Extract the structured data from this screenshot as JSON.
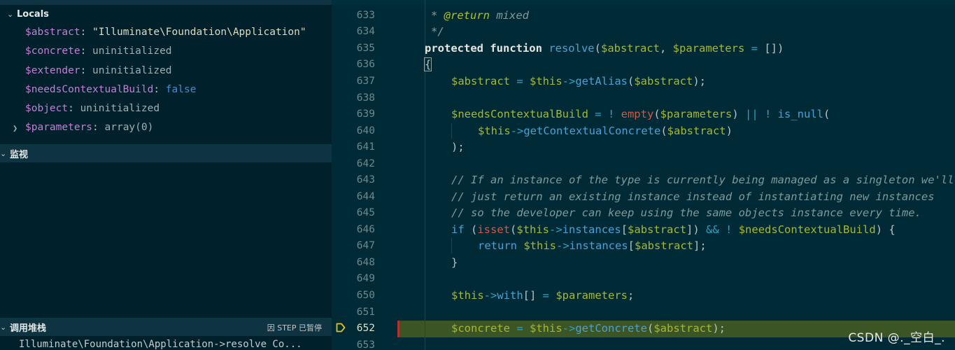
{
  "locals": {
    "header": "Locals",
    "vars": [
      {
        "name": "$abstract",
        "value": "\"Illuminate\\Foundation\\Application\"",
        "kind": "string"
      },
      {
        "name": "$concrete",
        "value": "uninitialized",
        "kind": "plain"
      },
      {
        "name": "$extender",
        "value": "uninitialized",
        "kind": "plain"
      },
      {
        "name": "$needsContextualBuild",
        "value": "false",
        "kind": "bool"
      },
      {
        "name": "$object",
        "value": "uninitialized",
        "kind": "plain"
      },
      {
        "name": "$parameters",
        "value": "array(0)",
        "kind": "plain"
      }
    ]
  },
  "watch": {
    "header": "监视"
  },
  "callstack": {
    "header": "调用堆栈",
    "status": "因 STEP 已暂停",
    "frame": "Illuminate\\Foundation\\Application->resolve  Co..."
  },
  "editor": {
    "current_line": 652,
    "lines": [
      {
        "n": "633",
        "code": "* @return mixed"
      },
      {
        "n": "634",
        "code": "*/"
      },
      {
        "n": "635",
        "code": "protected function resolve($abstract, $parameters = [])"
      },
      {
        "n": "636",
        "code": "{"
      },
      {
        "n": "637",
        "code": "$abstract = $this->getAlias($abstract);"
      },
      {
        "n": "638",
        "code": ""
      },
      {
        "n": "639",
        "code": "$needsContextualBuild = ! empty($parameters) || ! is_null("
      },
      {
        "n": "640",
        "code": "$this->getContextualConcrete($abstract)"
      },
      {
        "n": "641",
        "code": ");"
      },
      {
        "n": "642",
        "code": ""
      },
      {
        "n": "643",
        "code": "// If an instance of the type is currently being managed as a singleton we'll"
      },
      {
        "n": "644",
        "code": "// just return an existing instance instead of instantiating new instances"
      },
      {
        "n": "645",
        "code": "// so the developer can keep using the same objects instance every time."
      },
      {
        "n": "646",
        "code": "if (isset($this->instances[$abstract]) && ! $needsContextualBuild) {"
      },
      {
        "n": "647",
        "code": "return $this->instances[$abstract];"
      },
      {
        "n": "648",
        "code": "}"
      },
      {
        "n": "649",
        "code": ""
      },
      {
        "n": "650",
        "code": "$this->with[] = $parameters;"
      },
      {
        "n": "651",
        "code": ""
      },
      {
        "n": "652",
        "code": "$concrete = $this->getConcrete($abstract);"
      },
      {
        "n": "653",
        "code": ""
      }
    ]
  },
  "watermark": "CSDN @._空白_.",
  "colors": {
    "editor_bg": "#002b36",
    "panel_bg": "#00212b",
    "highlight": "#3b5525",
    "breakpoint": "#e3c21a"
  }
}
